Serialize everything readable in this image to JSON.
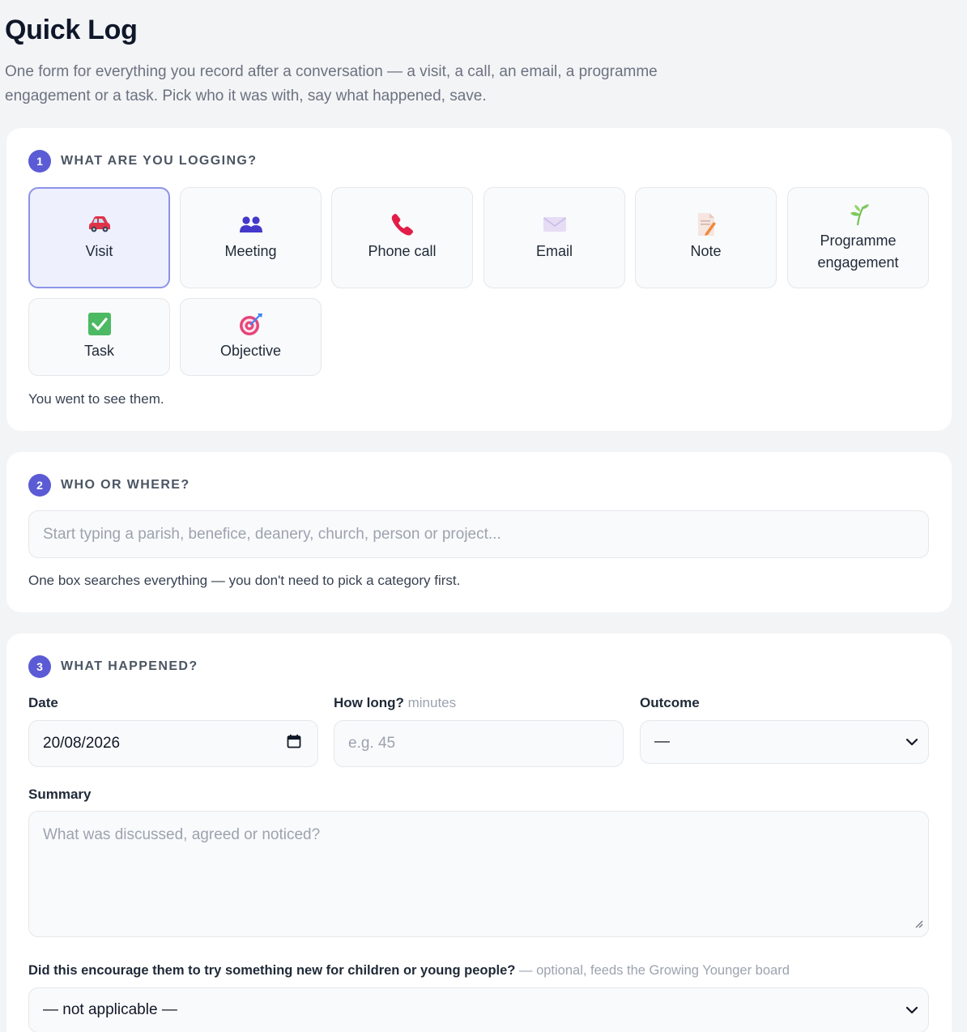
{
  "page": {
    "title": "Quick Log",
    "intro": "One form for everything you record after a conversation — a visit, a call, an email, a programme engagement or a task. Pick who it was with, say what happened, save."
  },
  "step1": {
    "number": "1",
    "label": "WHAT ARE YOU LOGGING?",
    "types": [
      {
        "label": "Visit",
        "icon": "car-icon",
        "selected": true
      },
      {
        "label": "Meeting",
        "icon": "people-icon",
        "selected": false
      },
      {
        "label": "Phone call",
        "icon": "phone-icon",
        "selected": false
      },
      {
        "label": "Email",
        "icon": "envelope-icon",
        "selected": false
      },
      {
        "label": "Note",
        "icon": "memo-icon",
        "selected": false
      },
      {
        "label": "Programme engagement",
        "icon": "seedling-icon",
        "selected": false
      },
      {
        "label": "Task",
        "icon": "check-box-icon",
        "selected": false
      },
      {
        "label": "Objective",
        "icon": "target-icon",
        "selected": false
      }
    ],
    "helper": "You went to see them."
  },
  "step2": {
    "number": "2",
    "label": "WHO OR WHERE?",
    "search_placeholder": "Start typing a parish, benefice, deanery, church, person or project...",
    "helper": "One box searches everything — you don't need to pick a category first."
  },
  "step3": {
    "number": "3",
    "label": "WHAT HAPPENED?",
    "date_label": "Date",
    "date_value": "20/08/2026",
    "duration_label": "How long?",
    "duration_unit": "minutes",
    "duration_placeholder": "e.g. 45",
    "outcome_label": "Outcome",
    "outcome_value": "—",
    "summary_label": "Summary",
    "summary_placeholder": "What was discussed, agreed or noticed?",
    "growing_label": "Did this encourage them to try something new for children or young people?",
    "growing_note": "— optional, feeds the Growing Younger board",
    "growing_value": "— not applicable —"
  },
  "colors": {
    "accent": "#5b5bd6",
    "selected_bg": "#eef0fe",
    "selected_border": "#8b93e6",
    "page_bg": "#f3f4f6"
  }
}
